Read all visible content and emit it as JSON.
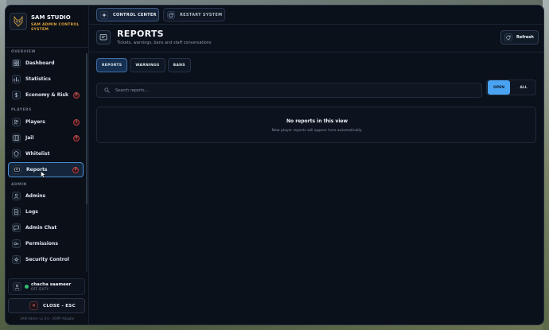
{
  "brand": {
    "title": "SAM STUDIO",
    "subtitle": "SAM ADMIN CONTROL SYSTEM"
  },
  "sidebar": {
    "sections": {
      "overview": "OVERVIEW",
      "players": "PLAYERS",
      "admin": "ADMIN"
    },
    "items": [
      {
        "label": "Dashboard",
        "icon": "grid-icon"
      },
      {
        "label": "Statistics",
        "icon": "bar-chart-icon"
      },
      {
        "label": "Economy & Risk",
        "icon": "dollar-icon",
        "badge": "0"
      },
      {
        "label": "Players",
        "icon": "users-icon",
        "badge": "1"
      },
      {
        "label": "Jail",
        "icon": "jail-icon",
        "badge": "0"
      },
      {
        "label": "Whitelist",
        "icon": "shield-icon"
      },
      {
        "label": "Reports",
        "icon": "report-icon",
        "badge": "0"
      },
      {
        "label": "Admins",
        "icon": "admins-icon"
      },
      {
        "label": "Logs",
        "icon": "document-icon"
      },
      {
        "label": "Admin Chat",
        "icon": "chat-icon"
      },
      {
        "label": "Permissions",
        "icon": "key-icon"
      },
      {
        "label": "Security Control",
        "icon": "gear-icon"
      }
    ]
  },
  "user": {
    "name": "chacha saameer",
    "status": "OFF DUTY"
  },
  "close_label": "CLOSE - ESC",
  "footer": "SAM Admin v1.0.0 · VORP Adapter",
  "topbar": {
    "control_center": "CONTROL CENTER",
    "restart_system": "RESTART SYSTEM"
  },
  "header": {
    "title": "REPORTS",
    "subtitle": "Tickets, warnings, bans and staff conversations",
    "refresh": "Refresh"
  },
  "tabs": [
    "REPORTS",
    "WARNINGS",
    "BANS"
  ],
  "search": {
    "placeholder": "Search reports..."
  },
  "filter": {
    "open": "OPEN",
    "all": "ALL"
  },
  "empty": {
    "title": "No reports in this view",
    "text": "New player reports will appear here automatically."
  },
  "colors": {
    "accent": "#4aa3f2",
    "brand_sub": "#e0a43a",
    "badge_red": "#b13a3a",
    "online": "#2fbf71"
  }
}
